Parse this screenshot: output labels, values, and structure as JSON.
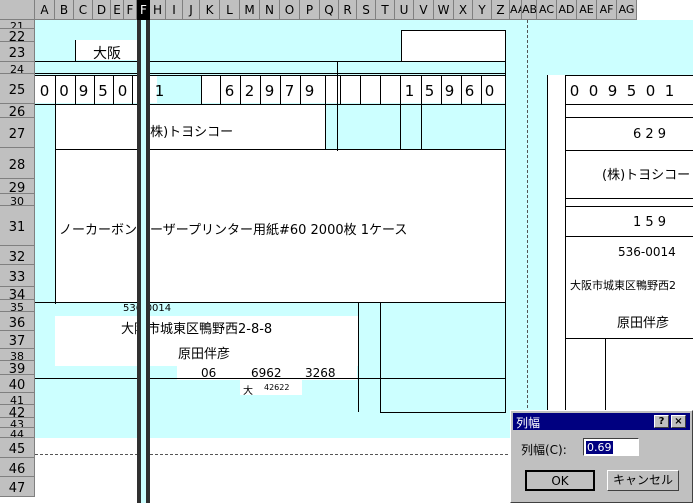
{
  "columns": [
    "A",
    "B",
    "C",
    "D",
    "E",
    "F",
    "G",
    "H",
    "I",
    "J",
    "K",
    "L",
    "M",
    "N",
    "O",
    "P",
    "Q",
    "R",
    "S",
    "T",
    "U",
    "V",
    "W",
    "X",
    "Y",
    "Z",
    "AA",
    "AB",
    "AC",
    "AD",
    "AE",
    "AF",
    "AG"
  ],
  "selected_column": "F",
  "rows": [
    "21",
    "22",
    "23",
    "24",
    "25",
    "26",
    "27",
    "28",
    "29",
    "30",
    "31",
    "32",
    "33",
    "34",
    "35",
    "36",
    "37",
    "38",
    "39",
    "40",
    "41",
    "42",
    "43",
    "44",
    "45",
    "46",
    "47"
  ],
  "form": {
    "prefecture": "大阪",
    "code_left": [
      "0",
      "0",
      "9",
      "5",
      "0",
      "1"
    ],
    "code_mid": [
      "6",
      "2",
      "9",
      "7",
      "9"
    ],
    "code_right": [
      "1",
      "5",
      "9",
      "6",
      "0"
    ],
    "company": "(株)トヨシコー",
    "product": "ノーカーボンレーザープリンター用紙#60  2000枚  1ケース",
    "postal": "536-0014",
    "address": "大阪市城東区鴨野西2-8-8",
    "person": "原田伴彦",
    "tel1": "06",
    "tel2": "6962",
    "tel3": "3268",
    "stamp_char": "大",
    "stamp_num": "42622"
  },
  "copy_form": {
    "code_digits": [
      "0",
      "0",
      "9",
      "5",
      "0",
      "1"
    ],
    "num_partial": "6 2 9",
    "company": "(株)トヨシコー",
    "num2_partial": "1 5 9",
    "postal": "536-0014",
    "address": "大阪市城東区鴨野西2",
    "person": "原田伴彦"
  },
  "dialog": {
    "title": "列幅",
    "help_label": "?",
    "close_label": "×",
    "field_label": "列幅(C):",
    "field_value": "0.69",
    "ok_label": "OK",
    "cancel_label": "キャンセル"
  }
}
